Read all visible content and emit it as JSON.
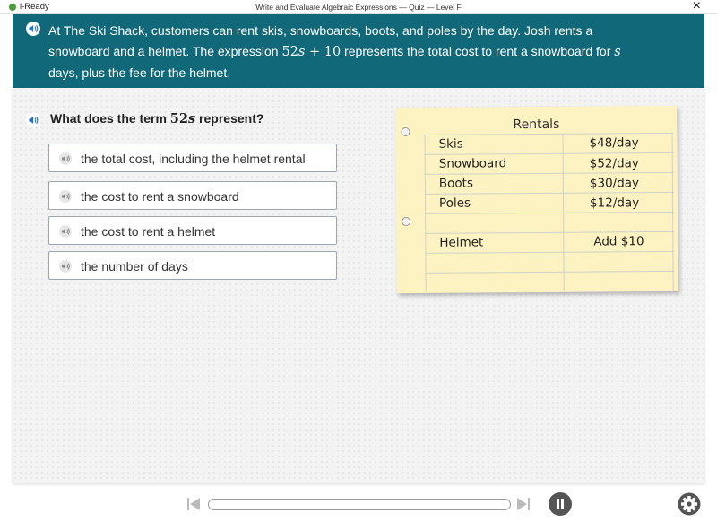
{
  "app": {
    "brand": "i-Ready",
    "window_title": "Write and Evaluate Algebraic Expressions — Quiz — Level F",
    "close_glyph": "×"
  },
  "prompt": {
    "text_before": "At The Ski Shack, customers can rent skis, snowboards, boots, and poles by the day. Josh rents a snowboard and a helmet. The expression ",
    "expr_coef": "52",
    "expr_var": "s",
    "expr_rest": " + 10",
    "text_middle": " represents the total cost to rent a snowboard for ",
    "days_var": "s",
    "text_after": " days, plus the fee for the helmet."
  },
  "question": {
    "text_before": "What does the term ",
    "term_coef": "52",
    "term_var": "s",
    "text_after": " represent?"
  },
  "options": [
    {
      "label": "the total cost, including the helmet rental"
    },
    {
      "label": "the cost to rent a snowboard"
    },
    {
      "label": "the cost to rent a helmet"
    },
    {
      "label": "the number of days"
    }
  ],
  "rentals": {
    "title": "Rentals",
    "rows": [
      {
        "item": "Skis",
        "price": "$48/day"
      },
      {
        "item": "Snowboard",
        "price": "$52/day"
      },
      {
        "item": "Boots",
        "price": "$30/day"
      },
      {
        "item": "Poles",
        "price": "$12/day"
      },
      {
        "item": "Helmet",
        "price": "Add $10"
      }
    ]
  },
  "icons": {
    "speaker": "speaker-icon",
    "prev": "skip-previous-icon",
    "next": "skip-next-icon",
    "pause": "pause-icon",
    "settings": "gear-icon"
  },
  "colors": {
    "banner": "#106878",
    "accent_speaker": "#1d6fd1",
    "notepad": "#fdf3c2"
  }
}
